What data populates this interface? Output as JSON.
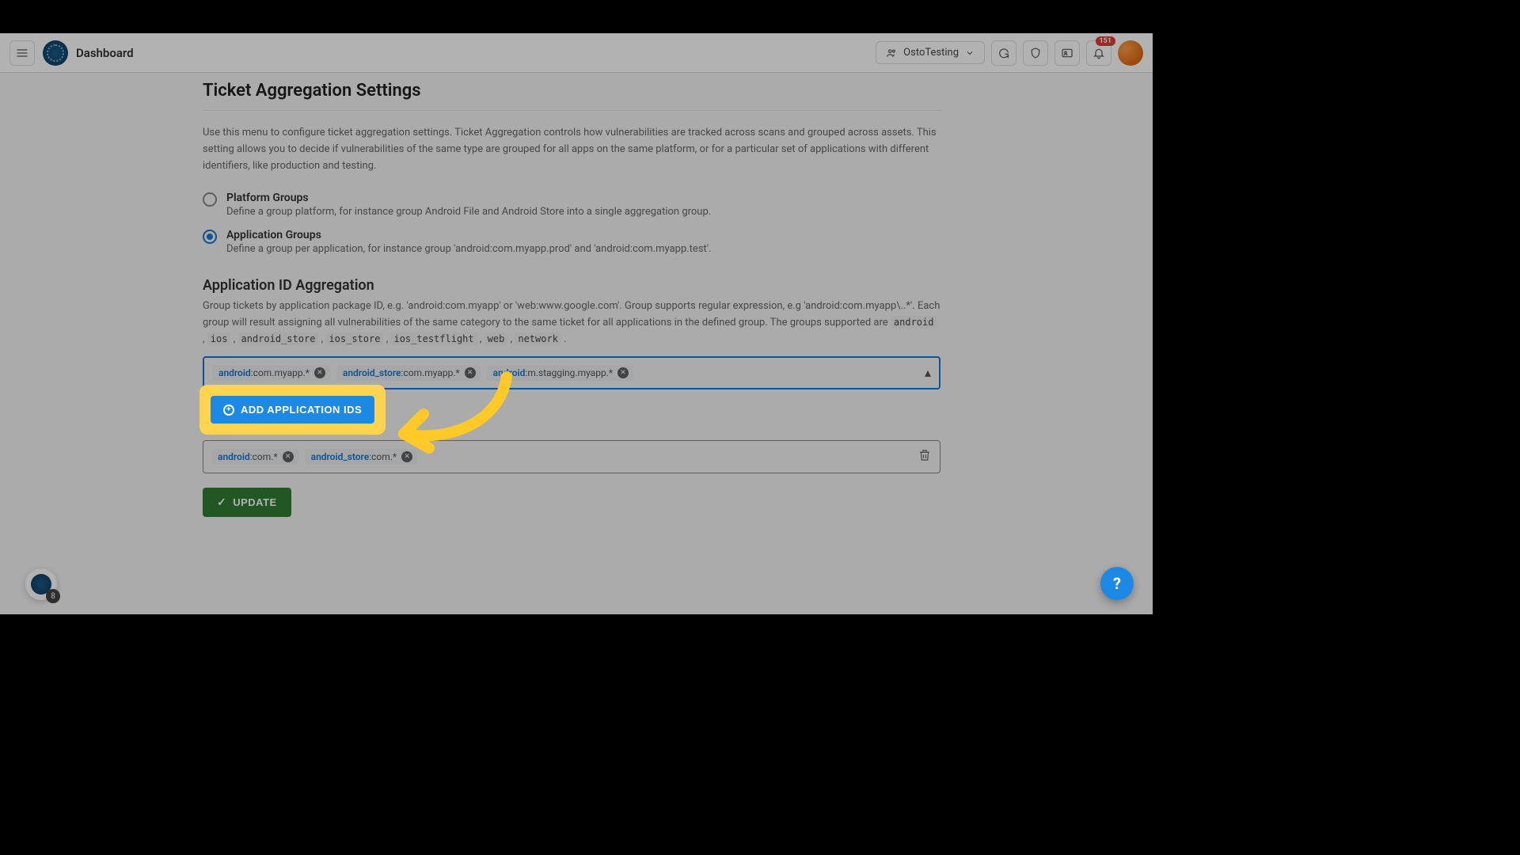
{
  "header": {
    "breadcrumb": "Dashboard",
    "org_name": "OstoTesting",
    "notification_count": "151"
  },
  "page": {
    "title": "Ticket Aggregation Settings",
    "intro": "Use this menu to configure ticket aggregation settings. Ticket Aggregation controls how vulnerabilities are tracked across scans and grouped across assets. This setting allows you to decide if vulnerabilities of the same type are grouped for all apps on the same platform, or for a particular set of applications with different identifiers, like production and testing."
  },
  "radios": [
    {
      "title": "Platform Groups",
      "desc": "Define a group platform, for instance group Android File and Android Store into a single aggregation group.",
      "selected": false
    },
    {
      "title": "Application Groups",
      "desc": "Define a group per application, for instance group 'android:com.myapp.prod' and 'android:com.myapp.test'.",
      "selected": true
    }
  ],
  "app_id_section": {
    "heading": "Application ID Aggregation",
    "desc_pre": "Group tickets by application package ID, e.g. 'android:com.myapp' or 'web:www.google.com'. Group supports regular expression, e.g 'android:com.myapp\\..*'. Each group will result assigning all vulnerabilities of the same category to the same ticket for all applications in the defined group. The groups supported are ",
    "codes": [
      "android",
      "ios",
      "android_store",
      "ios_store",
      "ios_testflight",
      "web",
      "network"
    ]
  },
  "chips_group1": [
    {
      "prefix": "android",
      "suffix": ":com.myapp.*"
    },
    {
      "prefix": "android_store",
      "suffix": ":com.myapp.*"
    },
    {
      "prefix": "android",
      "suffix": ":m.stagging.myapp.*"
    }
  ],
  "chips_group2": [
    {
      "prefix": "android",
      "suffix": ":com.*"
    },
    {
      "prefix": "android_store",
      "suffix": ":com.*"
    }
  ],
  "buttons": {
    "add_app_ids": "ADD APPLICATION IDS",
    "update": "UPDATE"
  },
  "widget": {
    "count": "8"
  }
}
